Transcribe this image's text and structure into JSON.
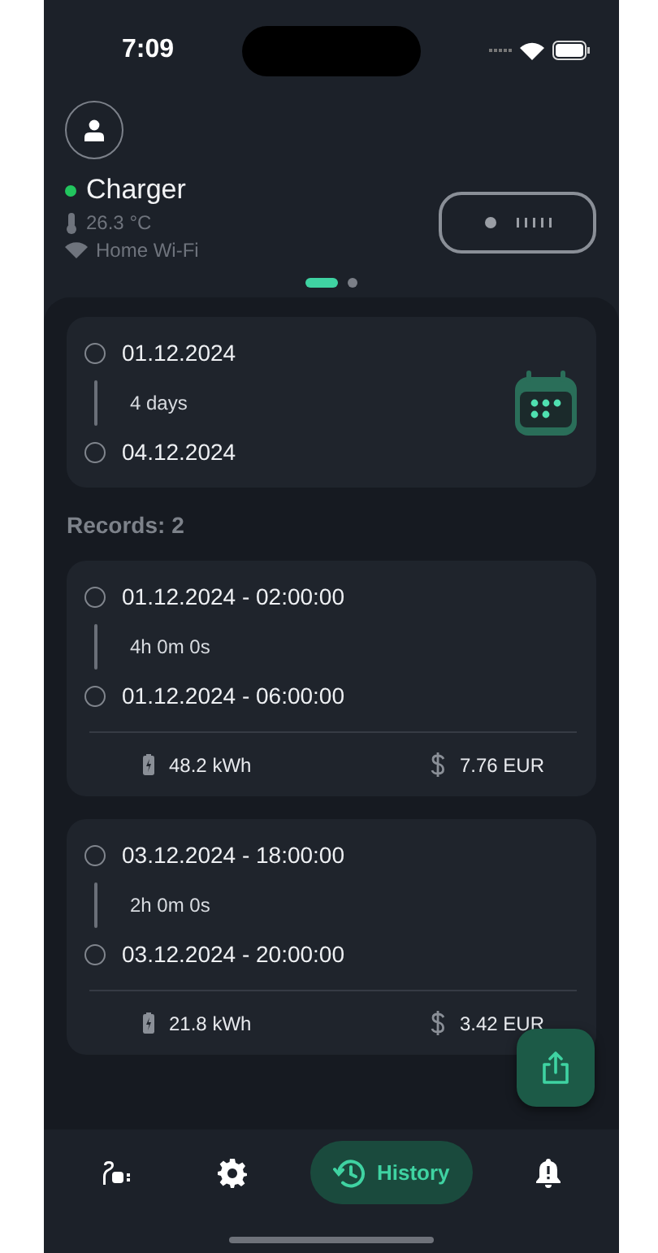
{
  "status_bar": {
    "time": "7:09"
  },
  "charger": {
    "name": "Charger",
    "online": true,
    "temperature": "26.3 °C",
    "network": "Home Wi-Fi"
  },
  "pager": [
    {
      "selected": true
    },
    {
      "selected": false
    }
  ],
  "date_range": {
    "start": "01.12.2024",
    "duration": "4 days",
    "end": "04.12.2024"
  },
  "records_label": "Records: 2",
  "records": [
    {
      "start": "01.12.2024 - 02:00:00",
      "duration": "4h 0m 0s",
      "end": "01.12.2024 - 06:00:00",
      "energy": "48.2 kWh",
      "cost": "7.76 EUR"
    },
    {
      "start": "03.12.2024 - 18:00:00",
      "duration": "2h 0m 0s",
      "end": "03.12.2024 - 20:00:00",
      "energy": "21.8 kWh",
      "cost": "3.42 EUR"
    }
  ],
  "nav": [
    {
      "kind": "charger",
      "selected": false
    },
    {
      "kind": "settings",
      "selected": false
    },
    {
      "kind": "history",
      "label": "History",
      "selected": true
    },
    {
      "kind": "alerts",
      "selected": false
    }
  ]
}
